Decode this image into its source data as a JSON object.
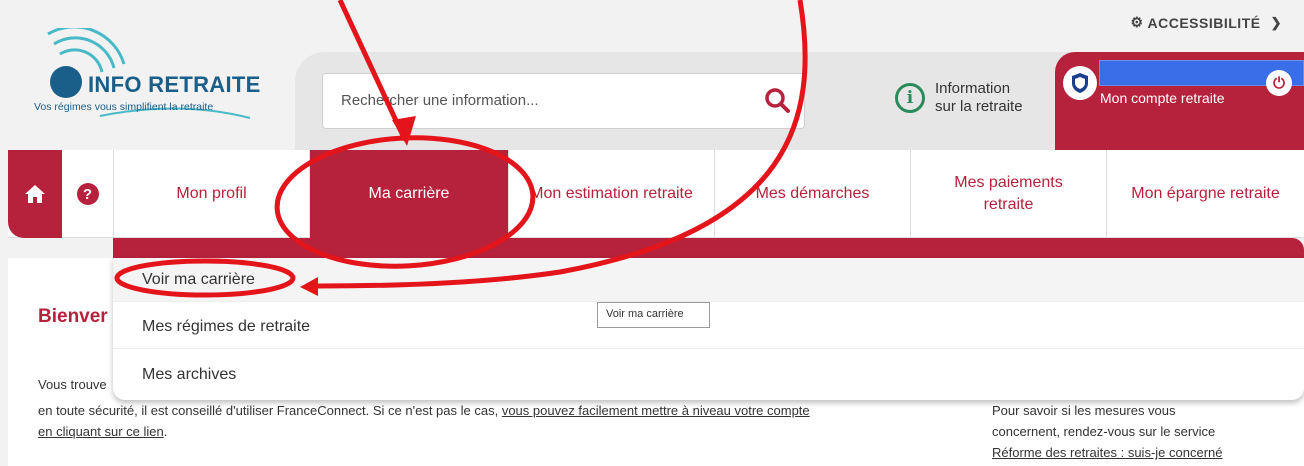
{
  "accessibility": {
    "label": "ACCESSIBILITÉ"
  },
  "logo": {
    "title": "INFO RETRAITE",
    "tagline": "Vos régimes vous simplifient la retraite"
  },
  "search": {
    "placeholder": "Rechercher une information..."
  },
  "info": {
    "line1": "Information",
    "line2": "sur la retraite"
  },
  "account": {
    "label": "Mon compte retraite"
  },
  "nav": {
    "items": [
      {
        "label": "Mon profil"
      },
      {
        "label": "Ma carrière"
      },
      {
        "label": "Mon estimation retraite"
      },
      {
        "label": "Mes démarches"
      },
      {
        "label": "Mes paiements retraite"
      },
      {
        "label": "Mon épargne retraite"
      }
    ]
  },
  "dropdown": {
    "items": [
      {
        "label": "Voir ma carrière"
      },
      {
        "label": "Mes régimes de retraite"
      },
      {
        "label": "Mes archives"
      }
    ],
    "tooltip": "Voir ma carrière"
  },
  "content": {
    "welcome": "Bienver",
    "line1": "Vous trouve",
    "line2_pre": "en toute sécurité, il est conseillé d'utiliser FranceConnect. Si ce n'est pas le cas,",
    "line2_link": "vous pouvez facilement mettre à niveau votre compte",
    "line3_link": "en cliquant sur ce lien",
    "line3_post": ".",
    "side_line1": "Pour savoir si les mesures vous",
    "side_line2": "concernent, rendez-vous sur le service",
    "side_link": "Réforme des retraites : suis-je concerné"
  },
  "colors": {
    "brand": "#b6213c",
    "logo_blue": "#1a5e8a",
    "info_green": "#2a8a5a",
    "annotation": "#e4141b"
  }
}
